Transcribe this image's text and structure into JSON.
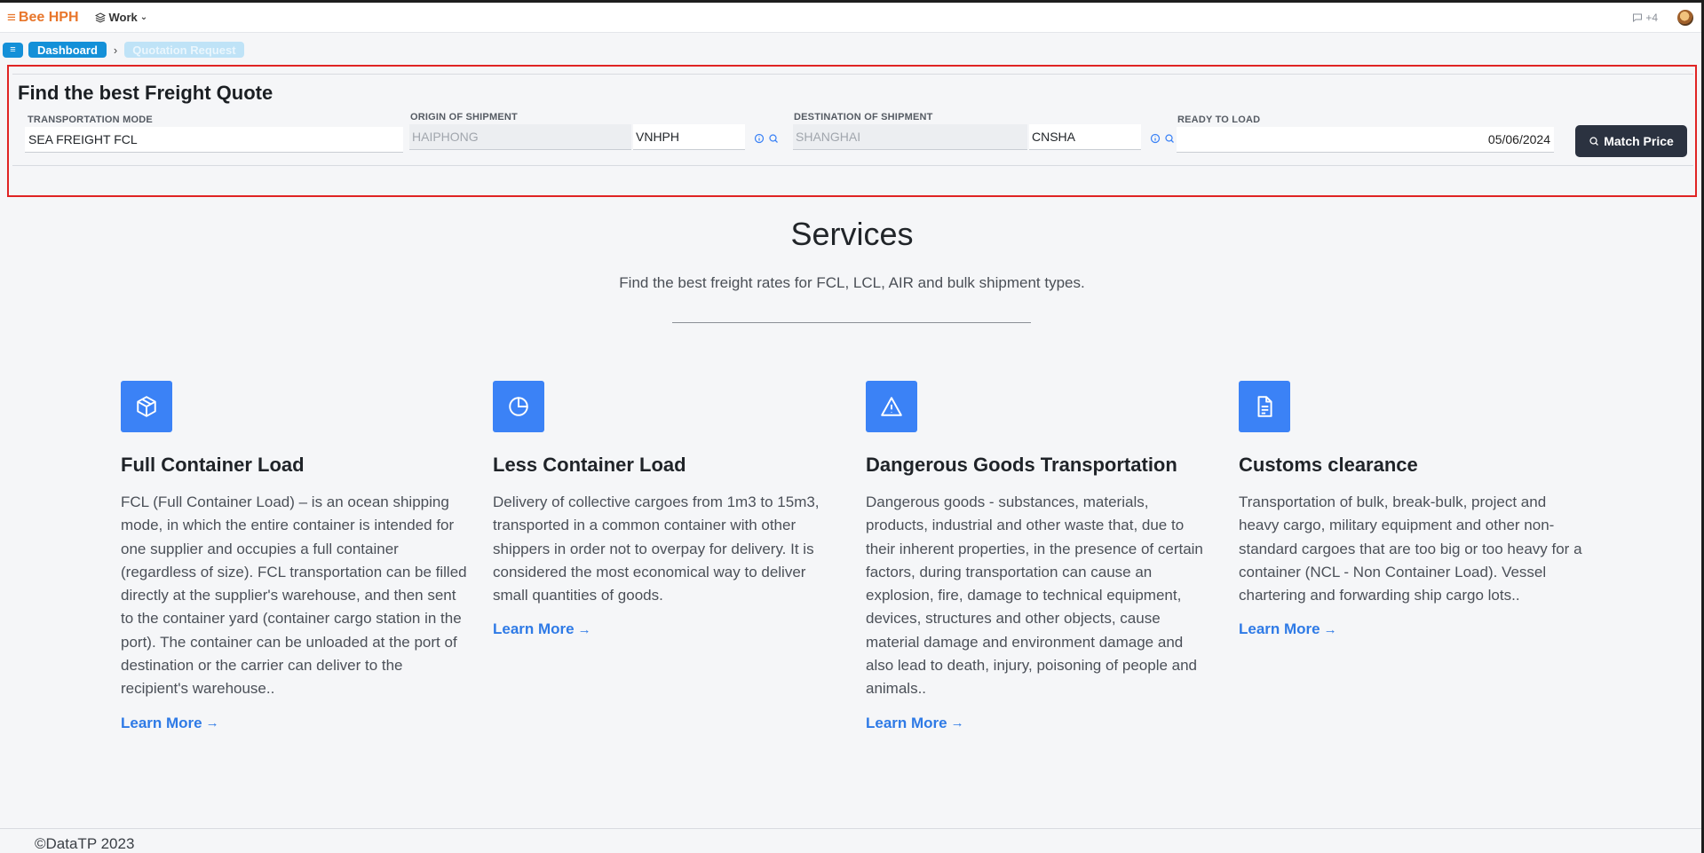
{
  "app": {
    "brand": "Bee HPH",
    "workspace": "Work",
    "notifications": "+4"
  },
  "breadcrumb": {
    "home": "Dashboard",
    "current": "Quotation Request"
  },
  "quote": {
    "title": "Find the best Freight Quote",
    "transport_label": "TRANSPORTATION MODE",
    "transport_value": "SEA FREIGHT FCL",
    "origin_label": "ORIGIN OF SHIPMENT",
    "origin_name": "HAIPHONG",
    "origin_code": "VNHPH",
    "dest_label": "DESTINATION OF SHIPMENT",
    "dest_name": "SHANGHAI",
    "dest_code": "CNSHA",
    "ready_label": "READY TO LOAD",
    "ready_value": "05/06/2024",
    "match_button": "Match Price"
  },
  "services": {
    "title": "Services",
    "subtitle": "Find the best freight rates for FCL, LCL, AIR and bulk shipment types.",
    "cards": [
      {
        "icon": "cube-icon",
        "title": "Full Container Load",
        "text": "FCL (Full Container Load) – is an ocean shipping mode, in which the entire container is intended for one supplier and occupies a full container (regardless of size). FCL transportation can be filled directly at the supplier's warehouse, and then sent to the container yard (container cargo station in the port). The container can be unloaded at the port of destination or the carrier can deliver to the recipient's warehouse..",
        "link": "Learn More"
      },
      {
        "icon": "pie-chart-icon",
        "title": "Less Container Load",
        "text": "Delivery of collective cargoes from 1m3 to 15m3, transported in a common container with other shippers in order not to overpay for delivery. It is considered the most economical way to deliver small quantities of goods.",
        "link": "Learn More"
      },
      {
        "icon": "warning-icon",
        "title": "Dangerous Goods Transportation",
        "text": "Dangerous goods - substances, materials, products, industrial and other waste that, due to their inherent properties, in the presence of certain factors, during transportation can cause an explosion, fire, damage to technical equipment, devices, structures and other objects, cause material damage and environment damage and also lead to death, injury, poisoning of people and animals..",
        "link": "Learn More"
      },
      {
        "icon": "document-icon",
        "title": "Customs clearance",
        "text": "Transportation of bulk, break-bulk, project and heavy cargo, military equipment and other non-standard cargoes that are too big or too heavy for a container (NCL - Non Container Load). Vessel chartering and forwarding ship cargo lots..",
        "link": "Learn More"
      }
    ]
  },
  "footer": {
    "copyright": "©DataTP 2023"
  },
  "colors": {
    "brand": "#e8762b",
    "primary": "#1490d8",
    "accent": "#3b82f6",
    "highlight": "#e02424",
    "button_dark": "#2b3240"
  }
}
